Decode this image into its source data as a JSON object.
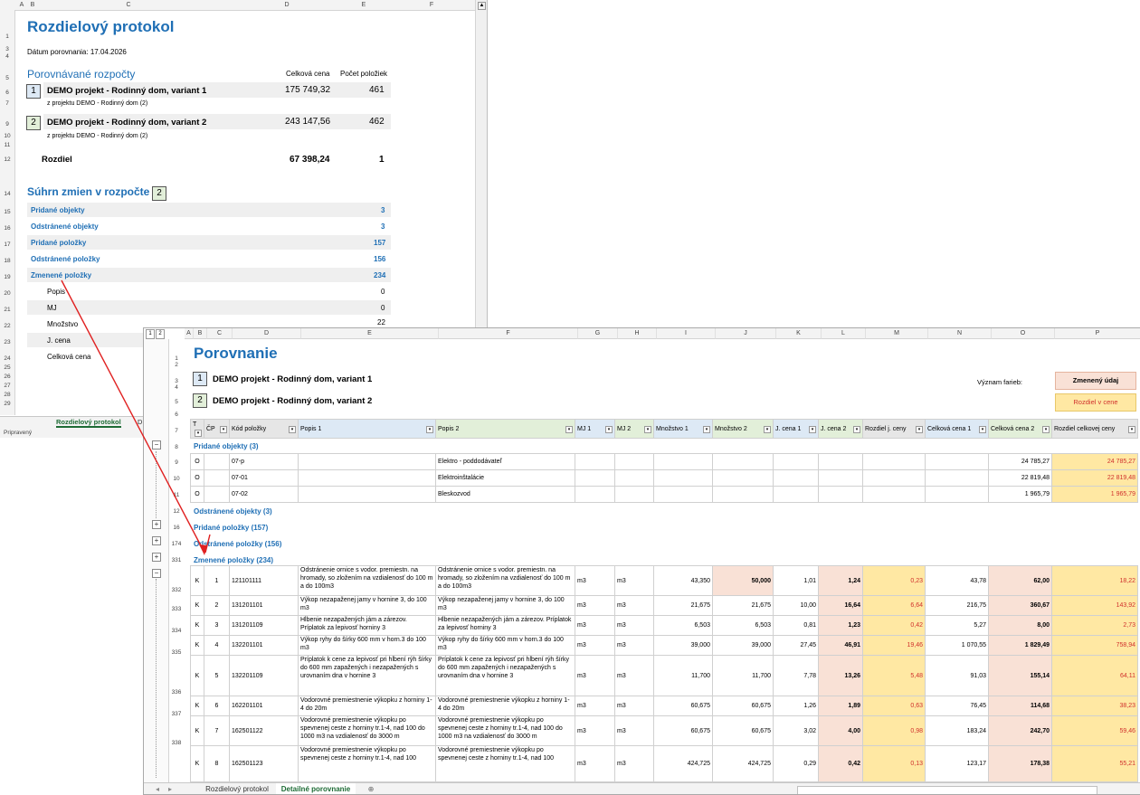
{
  "protocol": {
    "title": "Rozdielový protokol",
    "date_line": "Dátum porovnania: 17.04.2026",
    "compared_heading": "Porovnávané rozpočty",
    "col_total": "Celková cena",
    "col_count": "Počet položiek",
    "budget1": {
      "num": "1",
      "name": "DEMO projekt - Rodinný dom, variant 1",
      "from": "z projektu DEMO - Rodinný dom (2)",
      "total": "175 749,32",
      "count": "461"
    },
    "budget2": {
      "num": "2",
      "name": "DEMO projekt - Rodinný dom, variant 2",
      "from": "z projektu DEMO - Rodinný dom (2)",
      "total": "243 147,56",
      "count": "462"
    },
    "diff_label": "Rozdiel",
    "diff_total": "67 398,24",
    "diff_count": "1",
    "summary_heading": "Súhrn zmien v rozpočte",
    "summary_box": "2",
    "summary": [
      {
        "label": "Pridané objekty",
        "value": "3"
      },
      {
        "label": "Odstránené objekty",
        "value": "3"
      },
      {
        "label": "Pridané položky",
        "value": "157"
      },
      {
        "label": "Odstránené položky",
        "value": "156"
      },
      {
        "label": "Zmenené položky",
        "value": "234"
      }
    ],
    "changes": [
      {
        "label": "Popis",
        "value": "0"
      },
      {
        "label": "MJ",
        "value": "0"
      },
      {
        "label": "Množstvo",
        "value": "22"
      },
      {
        "label": "J. cena",
        "value": ""
      },
      {
        "label": "Celková cena",
        "value": ""
      }
    ],
    "sheet_tab": "Rozdielový protokol",
    "sheet_tab_next": "D",
    "status": "Pripravený"
  },
  "cols_back": [
    "A",
    "B",
    "C",
    "D",
    "E",
    "F"
  ],
  "rows_back": [
    "1",
    "2",
    "3",
    "4",
    "5",
    "6",
    "7",
    "8",
    "9",
    "10",
    "11",
    "12",
    "13",
    "14",
    "15",
    "16",
    "17",
    "18",
    "19",
    "20",
    "21",
    "22",
    "23",
    "24",
    "25",
    "26",
    "27",
    "28",
    "29"
  ],
  "compare": {
    "outline_levels": [
      "1",
      "2"
    ],
    "cols": [
      "A",
      "B",
      "C",
      "D",
      "E",
      "F",
      "G",
      "H",
      "I",
      "J",
      "K",
      "L",
      "M",
      "N",
      "O",
      "P"
    ],
    "title": "Porovnanie",
    "b1_num": "1",
    "b1_name": "DEMO projekt - Rodinný dom, variant 1",
    "b2_num": "2",
    "b2_name": "DEMO projekt - Rodinný dom, variant 2",
    "legend_label": "Význam farieb:",
    "legend_changed": "Zmenený údaj",
    "legend_diff": "Rozdiel v cene",
    "headers": [
      "T",
      "ČP",
      "Kód položky",
      "Popis 1",
      "Popis 2",
      "MJ 1",
      "MJ 2",
      "Množstvo 1",
      "Množstvo 2",
      "J. cena 1",
      "J. cena 2",
      "Rozdiel j. ceny",
      "Celková cena 1",
      "Celková cena 2",
      "Rozdiel celkovej ceny"
    ],
    "row_numbers": {
      "top": [
        "1",
        "2",
        "3",
        "4",
        "5",
        "6",
        "7"
      ],
      "added_objects": "8",
      "ao_rows": [
        "9",
        "10",
        "11"
      ],
      "removed_objects": "12",
      "added_items": "16",
      "removed_items": "174",
      "changed_items": "331"
    },
    "sec_added_objects": "Pridané objekty (3)",
    "sec_removed_objects": "Odstránené objekty (3)",
    "sec_added_items": "Pridané položky (157)",
    "sec_removed_items": "Odstránené položky (156)",
    "sec_changed_items": "Zmenené položky (234)",
    "added_objects": [
      {
        "t": "O",
        "code": "07-p",
        "desc2": "Elektro - poddodávateľ",
        "total2": "24 785,27",
        "diff": "24 785,27"
      },
      {
        "t": "O",
        "code": "07-01",
        "desc2": "Elektroinštalácie",
        "total2": "22 819,48",
        "diff": "22 819,48"
      },
      {
        "t": "O",
        "code": "07-02",
        "desc2": "Bleskozvod",
        "total2": "1 965,79",
        "diff": "1 965,79"
      }
    ],
    "items": [
      {
        "row": "332",
        "t": "K",
        "cp": "1",
        "code": "121101111",
        "d1": "Odstránenie ornice s vodor. premiestn. na hromady, so zložením na vzdialenosť do 100 m a do 100m3",
        "d2": "Odstránenie ornice s vodor. premiestn. na hromady, so zložením na vzdialenosť do 100 m a do 100m3",
        "mj1": "m3",
        "mj2": "m3",
        "q1": "43,350",
        "q2": "50,000",
        "p1": "1,01",
        "p2": "1,24",
        "dp": "0,23",
        "t1": "43,78",
        "t2": "62,00",
        "dt": "18,22",
        "q2chg": true
      },
      {
        "row": "333",
        "t": "K",
        "cp": "2",
        "code": "131201101",
        "d1": "Výkop nezapaženej jamy v hornine 3, do 100 m3",
        "d2": "Výkop nezapaženej jamy v hornine 3, do 100 m3",
        "mj1": "m3",
        "mj2": "m3",
        "q1": "21,675",
        "q2": "21,675",
        "p1": "10,00",
        "p2": "16,64",
        "dp": "6,64",
        "t1": "216,75",
        "t2": "360,67",
        "dt": "143,92"
      },
      {
        "row": "334",
        "t": "K",
        "cp": "3",
        "code": "131201109",
        "d1": "Hĺbenie nezapažených jám a zárezov. Príplatok za lepivosť horniny 3",
        "d2": "Hĺbenie nezapažených jám a zárezov. Príplatok za lepivosť horniny 3",
        "mj1": "m3",
        "mj2": "m3",
        "q1": "6,503",
        "q2": "6,503",
        "p1": "0,81",
        "p2": "1,23",
        "dp": "0,42",
        "t1": "5,27",
        "t2": "8,00",
        "dt": "2,73"
      },
      {
        "row": "335",
        "t": "K",
        "cp": "4",
        "code": "132201101",
        "d1": "Výkop ryhy do šírky 600 mm v horn.3 do 100 m3",
        "d2": "Výkop ryhy do šírky 600 mm v horn.3 do 100 m3",
        "mj1": "m3",
        "mj2": "m3",
        "q1": "39,000",
        "q2": "39,000",
        "p1": "27,45",
        "p2": "46,91",
        "dp": "19,46",
        "t1": "1 070,55",
        "t2": "1 829,49",
        "dt": "758,94"
      },
      {
        "row": "336",
        "t": "K",
        "cp": "5",
        "code": "132201109",
        "d1": "Príplatok k cene za lepivosť pri hĺbení rýh šírky do 600 mm zapažených i nezapažených s urovnaním dna v hornine 3",
        "d2": "Príplatok k cene za lepivosť pri hĺbení rýh šírky do 600 mm zapažených i nezapažených s urovnaním dna v hornine 3",
        "mj1": "m3",
        "mj2": "m3",
        "q1": "11,700",
        "q2": "11,700",
        "p1": "7,78",
        "p2": "13,26",
        "dp": "5,48",
        "t1": "91,03",
        "t2": "155,14",
        "dt": "64,11"
      },
      {
        "row": "337",
        "t": "K",
        "cp": "6",
        "code": "162201101",
        "d1": "Vodorovné premiestnenie výkopku z horniny 1-4 do 20m",
        "d2": "Vodorovné premiestnenie výkopku z horniny 1-4 do 20m",
        "mj1": "m3",
        "mj2": "m3",
        "q1": "60,675",
        "q2": "60,675",
        "p1": "1,26",
        "p2": "1,89",
        "dp": "0,63",
        "t1": "76,45",
        "t2": "114,68",
        "dt": "38,23"
      },
      {
        "row": "338",
        "t": "K",
        "cp": "7",
        "code": "162501122",
        "d1": "Vodorovné premiestnenie výkopku po spevnenej ceste z horniny tr.1-4, nad 100 do 1000 m3 na vzdialenosť do 3000 m",
        "d2": "Vodorovné premiestnenie výkopku po spevnenej ceste z horniny tr.1-4, nad 100 do 1000 m3 na vzdialenosť do 3000 m",
        "mj1": "m3",
        "mj2": "m3",
        "q1": "60,675",
        "q2": "60,675",
        "p1": "3,02",
        "p2": "4,00",
        "dp": "0,98",
        "t1": "183,24",
        "t2": "242,70",
        "dt": "59,46"
      },
      {
        "row": "",
        "t": "K",
        "cp": "8",
        "code": "162501123",
        "d1": "Vodorovné premiestnenie výkopku po spevnenej ceste z horniny tr.1-4, nad 100",
        "d2": "Vodorovné premiestnenie výkopku po spevnenej ceste z horniny tr.1-4, nad 100",
        "mj1": "m3",
        "mj2": "m3",
        "q1": "424,725",
        "q2": "424,725",
        "p1": "0,29",
        "p2": "0,42",
        "dp": "0,13",
        "t1": "123,17",
        "t2": "178,38",
        "dt": "55,21"
      }
    ],
    "tab1": "Rozdielový protokol",
    "tab2": "Detailné porovnanie",
    "add_tab": "⊕"
  },
  "colors": {
    "accent": "#1f6fb5",
    "changed": "#f9e1d6",
    "diff": "#ffe8a3",
    "red": "#d0312d",
    "green_tab": "#1d6b35"
  },
  "icons": [
    "plus-icon",
    "minus-icon",
    "filter-arrow-icon",
    "arrow-icon",
    "add-sheet-icon"
  ]
}
